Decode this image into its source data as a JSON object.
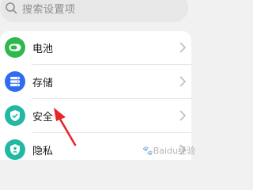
{
  "search": {
    "placeholder": "搜索设置项"
  },
  "settings": {
    "items": [
      {
        "label": "电池",
        "icon": "battery-icon",
        "color": "#2fb84d"
      },
      {
        "label": "存储",
        "icon": "storage-icon",
        "color": "#2f6df0"
      },
      {
        "label": "安全",
        "icon": "shield-check-icon",
        "color": "#23b8a3"
      },
      {
        "label": "隐私",
        "icon": "privacy-shield-icon",
        "color": "#23b8a3"
      }
    ]
  },
  "annotation": {
    "arrow_color": "#e8262a"
  },
  "watermark": {
    "text": "Baidu经验"
  }
}
